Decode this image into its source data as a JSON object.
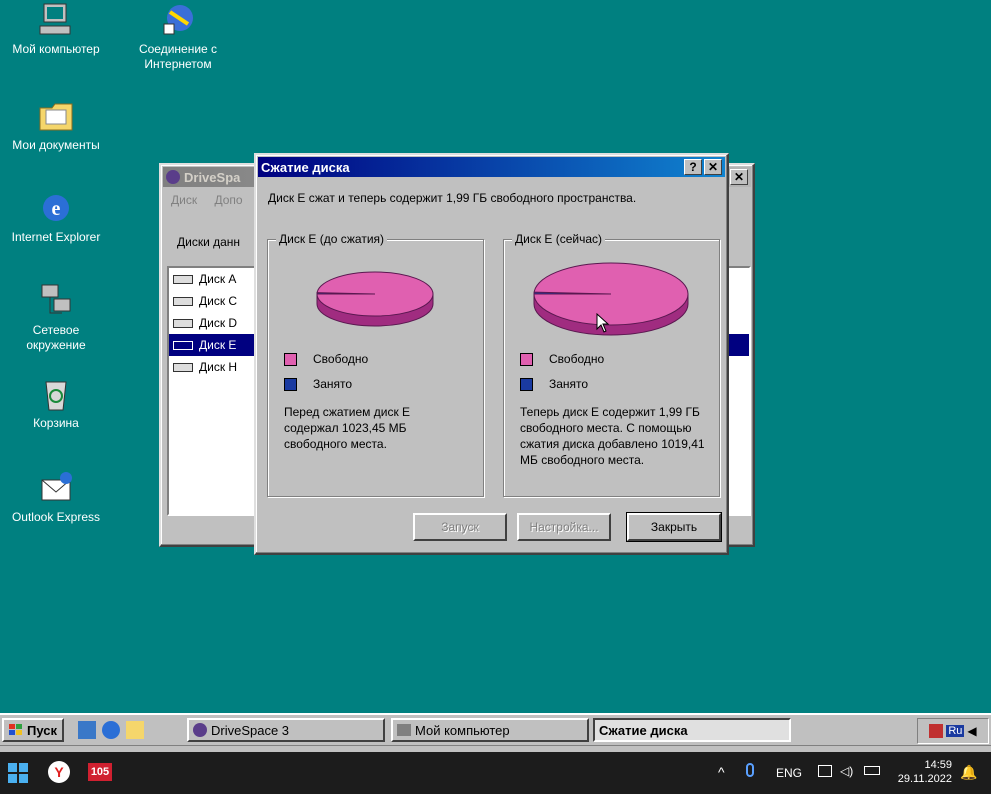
{
  "desktop": {
    "icons": [
      {
        "label": "Мой компьютер",
        "icon": "my-computer-icon"
      },
      {
        "label": "Соединение с Интернетом",
        "icon": "internet-connection-icon"
      },
      {
        "label": "Мои документы",
        "icon": "folder-icon"
      },
      {
        "label": "Internet Explorer",
        "icon": "internet-explorer-icon"
      },
      {
        "label": "Сетевое окружение",
        "icon": "network-icon"
      },
      {
        "label": "Корзина",
        "icon": "recycle-bin-icon"
      },
      {
        "label": "Outlook Express",
        "icon": "outlook-express-icon"
      }
    ]
  },
  "drivespace": {
    "title": "DriveSpa",
    "menu": [
      "Диск",
      "Допо"
    ],
    "list_header": "Диски данн",
    "drives": [
      "Диск A",
      "Диск C",
      "Диск D",
      "Диск E",
      "Диск H"
    ],
    "selected_index": 3
  },
  "dialog": {
    "title": "Сжатие диска",
    "help": "?",
    "close": "✕",
    "summary": "Диск E сжат и теперь содержит 1,99 ГБ свободного пространства.",
    "before": {
      "label": "Диск E (до сжатия)",
      "legend_free": "Свободно",
      "legend_used": "Занято",
      "text": "Перед сжатием диск E содержал 1023,45 МБ свободного места.",
      "free_fraction": 0.99
    },
    "after": {
      "label": "Диск E (сейчас)",
      "legend_free": "Свободно",
      "legend_used": "Занято",
      "text": "Теперь диск E содержит 1,99 ГБ свободного места. С помощью сжатия диска добавлено 1019,41 МБ свободного места.",
      "free_fraction": 0.99
    },
    "buttons": {
      "run": "Запуск",
      "settings": "Настройка...",
      "close": "Закрыть"
    },
    "colors": {
      "free": "#e060b0",
      "free_side": "#a02c80",
      "used": "#1a3aa0"
    }
  },
  "taskbar": {
    "start": "Пуск",
    "tasks": [
      "DriveSpace 3",
      "Мой компьютер",
      "Сжатие диска"
    ],
    "active_task": 2,
    "tray_lang": "Ru"
  },
  "host": {
    "lang": "ENG",
    "time": "14:59",
    "date": "29.11.2022",
    "app_badge": "105"
  }
}
